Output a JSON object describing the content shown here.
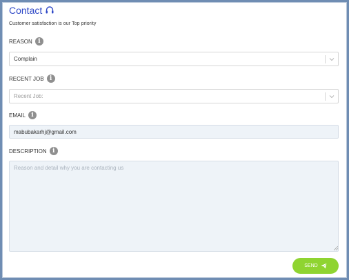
{
  "header": {
    "title": "Contact",
    "subtitle": "Customer satisfaction is our Top priority"
  },
  "icons": {
    "title_icon": "headset-icon",
    "info_icon": "info-icon",
    "dropdown_icon": "chevron-down-icon",
    "send_icon": "paper-plane-icon"
  },
  "form": {
    "reason": {
      "label": "REASON",
      "value": "Complain"
    },
    "recent_job": {
      "label": "RECENT JOB",
      "placeholder": "Recent Job:"
    },
    "email": {
      "label": "EMAIL",
      "value": "mabubakarhj@gmail.com"
    },
    "description": {
      "label": "DESCRIPTION",
      "placeholder": "Reason and detail why you are contacting us"
    },
    "send_label": "SEND"
  },
  "colors": {
    "title": "#2f49c7",
    "send_button": "#8fd431",
    "frame_border": "#6f8db3",
    "input_background": "#eef3f8",
    "info_icon": "#8f8f8f"
  }
}
